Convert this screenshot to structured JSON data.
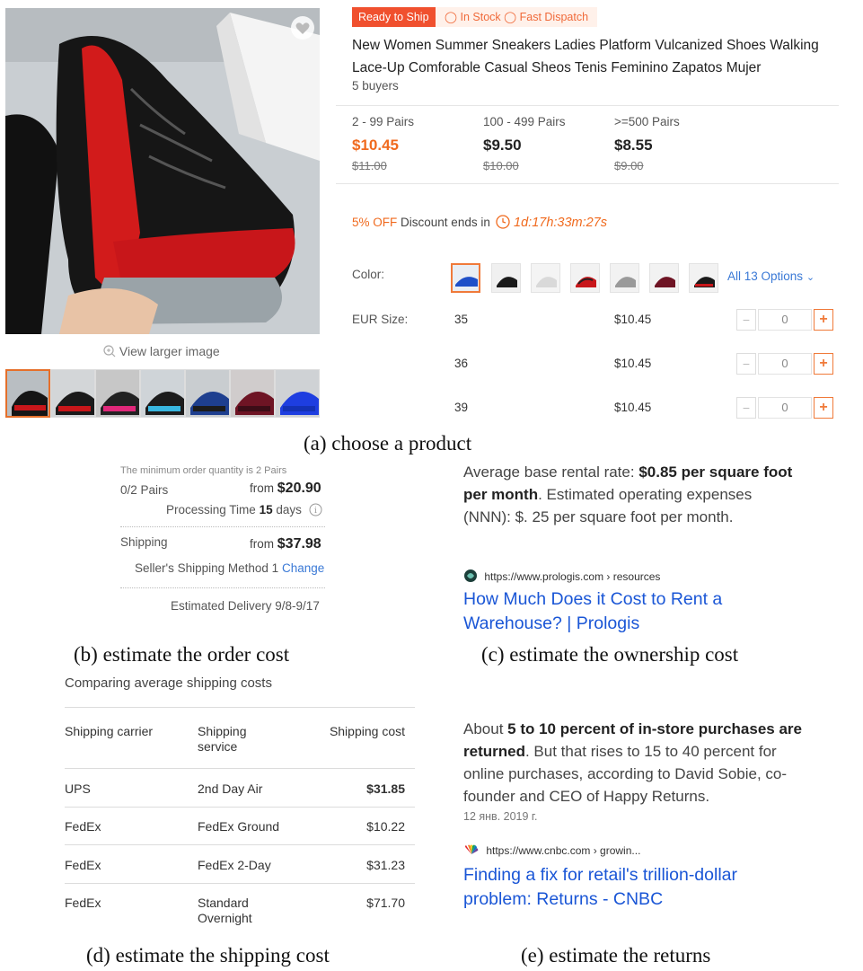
{
  "product": {
    "badge_ready": "Ready to Ship",
    "badge_stock": "In Stock",
    "badge_dispatch": "Fast Dispatch",
    "title": "New Women Summer Sneakers Ladies Platform Vulcanized Shoes Walking Lace-Up Comforable Casual Sheos Tenis Feminino Zapatos Mujer",
    "buyers": "5 buyers",
    "view_larger": "View larger image",
    "tiers": [
      {
        "qty": "2 - 99 Pairs",
        "price": "$10.45",
        "old": "$11.00"
      },
      {
        "qty": "100 - 499 Pairs",
        "price": "$9.50",
        "old": "$10.00"
      },
      {
        "qty": ">=500 Pairs",
        "price": "$8.55",
        "old": "$9.00"
      }
    ],
    "discount_pct": "5% OFF",
    "discount_text": "Discount ends in",
    "timer": "1d:17h:33m:27s",
    "color_label": "Color:",
    "all_options": "All 13 Options",
    "size_label": "EUR Size:",
    "sizes": [
      {
        "size": "35",
        "price": "$10.45",
        "qty": "0"
      },
      {
        "size": "36",
        "price": "$10.45",
        "qty": "0"
      },
      {
        "size": "39",
        "price": "$10.45",
        "qty": "0"
      }
    ],
    "minus": "−",
    "plus": "+",
    "colors": {
      "accent": "#f06a1e",
      "link": "#3a79d6"
    }
  },
  "order": {
    "min_note": "The minimum order quantity is 2 Pairs",
    "pairs": "0/2 Pairs",
    "from": "from",
    "subtotal": "$20.90",
    "processing_label": "Processing Time",
    "processing_days": "15",
    "processing_unit": "days",
    "shipping_label": "Shipping",
    "shipping_cost": "$37.98",
    "method": "Seller's Shipping Method 1",
    "change": "Change",
    "delivery": "Estimated Delivery 9/8-9/17"
  },
  "rental": {
    "text_1": "Average base rental rate: ",
    "bold_1": "$0.85 per square foot per month",
    "text_2": ". Estimated operating expenses (NNN): $. 25 per square foot per month.",
    "source": "https://www.prologis.com › resources",
    "link": "How Much Does it Cost to Rent a Warehouse? | Prologis"
  },
  "shipping_table": {
    "heading": "Comparing average shipping costs",
    "headers": [
      "Shipping carrier",
      "Shipping service",
      "Shipping cost"
    ],
    "rows": [
      {
        "carrier": "UPS",
        "service": "2nd Day Air",
        "cost": "$31.85"
      },
      {
        "carrier": "FedEx",
        "service": "FedEx Ground",
        "cost": "$10.22"
      },
      {
        "carrier": "FedEx",
        "service": "FedEx 2-Day",
        "cost": "$31.23"
      },
      {
        "carrier": "FedEx",
        "service": "Standard Overnight",
        "cost": "$71.70"
      }
    ]
  },
  "returns": {
    "text_1": "About ",
    "bold_1": "5 to 10 percent of in-store purchases are returned",
    "text_2": ". But that rises to 15 to 40 percent for online purchases, according to David Sobie, co-founder and CEO of Happy Returns.",
    "date": "12 янв. 2019 г.",
    "source": "https://www.cnbc.com › growin...",
    "link": "Finding a fix for retail's trillion-dollar problem: Returns - CNBC"
  },
  "captions": {
    "a": "(a) choose a product",
    "b": "(b) estimate the order cost",
    "c": "(c) estimate the ownership cost",
    "d": "(d) estimate the shipping cost",
    "e": "(e) estimate the returns"
  }
}
